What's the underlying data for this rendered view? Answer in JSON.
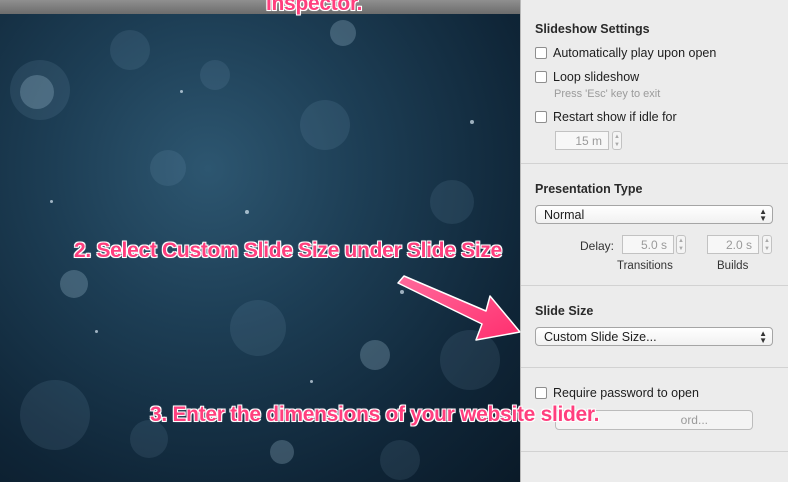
{
  "annotations": {
    "top": "Inspector.",
    "step2": "2. Select Custom Slide Size under Slide Size",
    "step3": "3. Enter the dimensions of your website slider."
  },
  "inspector": {
    "slideshow": {
      "title": "Slideshow Settings",
      "autoplay_label": "Automatically play upon open",
      "loop_label": "Loop slideshow",
      "loop_hint": "Press 'Esc' key to exit",
      "restart_label": "Restart show if idle for",
      "idle_value": "15 m"
    },
    "presentation": {
      "title": "Presentation Type",
      "type_value": "Normal",
      "delay_label": "Delay:",
      "transitions_value": "5.0 s",
      "transitions_label": "Transitions",
      "builds_value": "2.0 s",
      "builds_label": "Builds"
    },
    "slide_size": {
      "title": "Slide Size",
      "value": "Custom Slide Size..."
    },
    "password": {
      "require_label": "Require password to open",
      "button_label": "ord..."
    }
  },
  "colors": {
    "annotation": "#ff3f7e",
    "inspector_bg": "#ececec",
    "canvas_dark": "#0f2537"
  },
  "icons": {
    "popup_arrows": "up-down-chevrons-icon",
    "stepper": "stepper-icon",
    "annotation_arrow": "pink-arrow-icon"
  }
}
